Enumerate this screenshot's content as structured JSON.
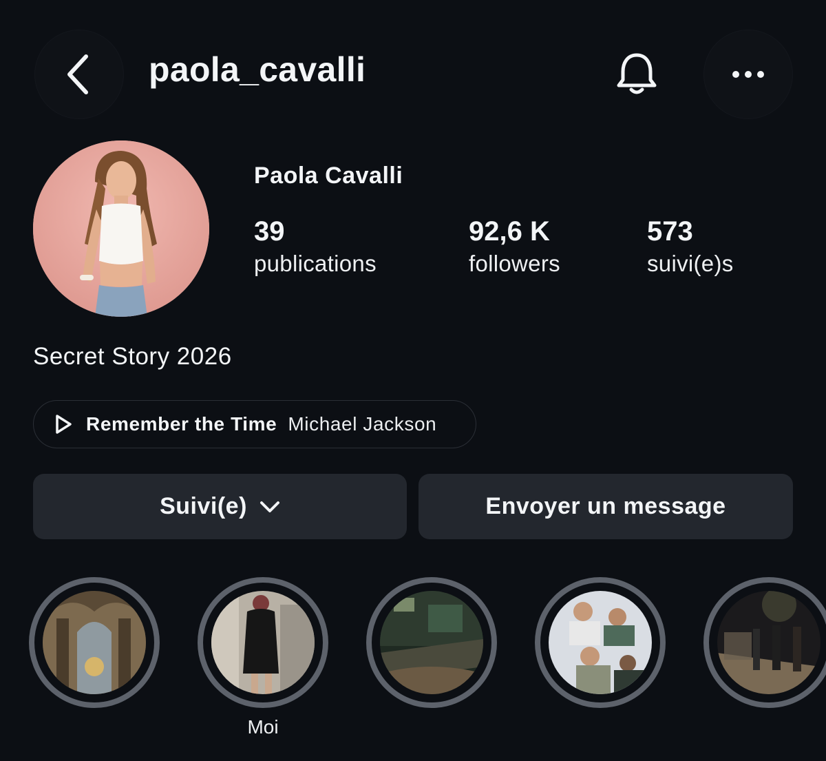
{
  "header": {
    "username": "paola_cavalli",
    "back_icon": "chevron-left-icon",
    "bell_icon": "bell-icon",
    "more_icon": "more-horizontal-icon"
  },
  "profile": {
    "full_name": "Paola Cavalli",
    "stats": [
      {
        "value": "39",
        "label": "publications"
      },
      {
        "value": "92,6 K",
        "label": "followers"
      },
      {
        "value": "573",
        "label": "suivi(e)s"
      }
    ],
    "bio": "Secret Story 2026"
  },
  "music": {
    "title": "Remember the Time",
    "artist": "Michael Jackson",
    "icon": "play-icon"
  },
  "actions": {
    "follow_label": "Suivi(e)",
    "message_label": "Envoyer un message"
  },
  "highlights": [
    {
      "label": ""
    },
    {
      "label": "Moi"
    },
    {
      "label": ""
    },
    {
      "label": ""
    },
    {
      "label": ""
    }
  ],
  "colors": {
    "background": "#0c0f14",
    "button_bg": "#23272e",
    "ring": "#5d626b",
    "text": "#f3f5f7"
  }
}
